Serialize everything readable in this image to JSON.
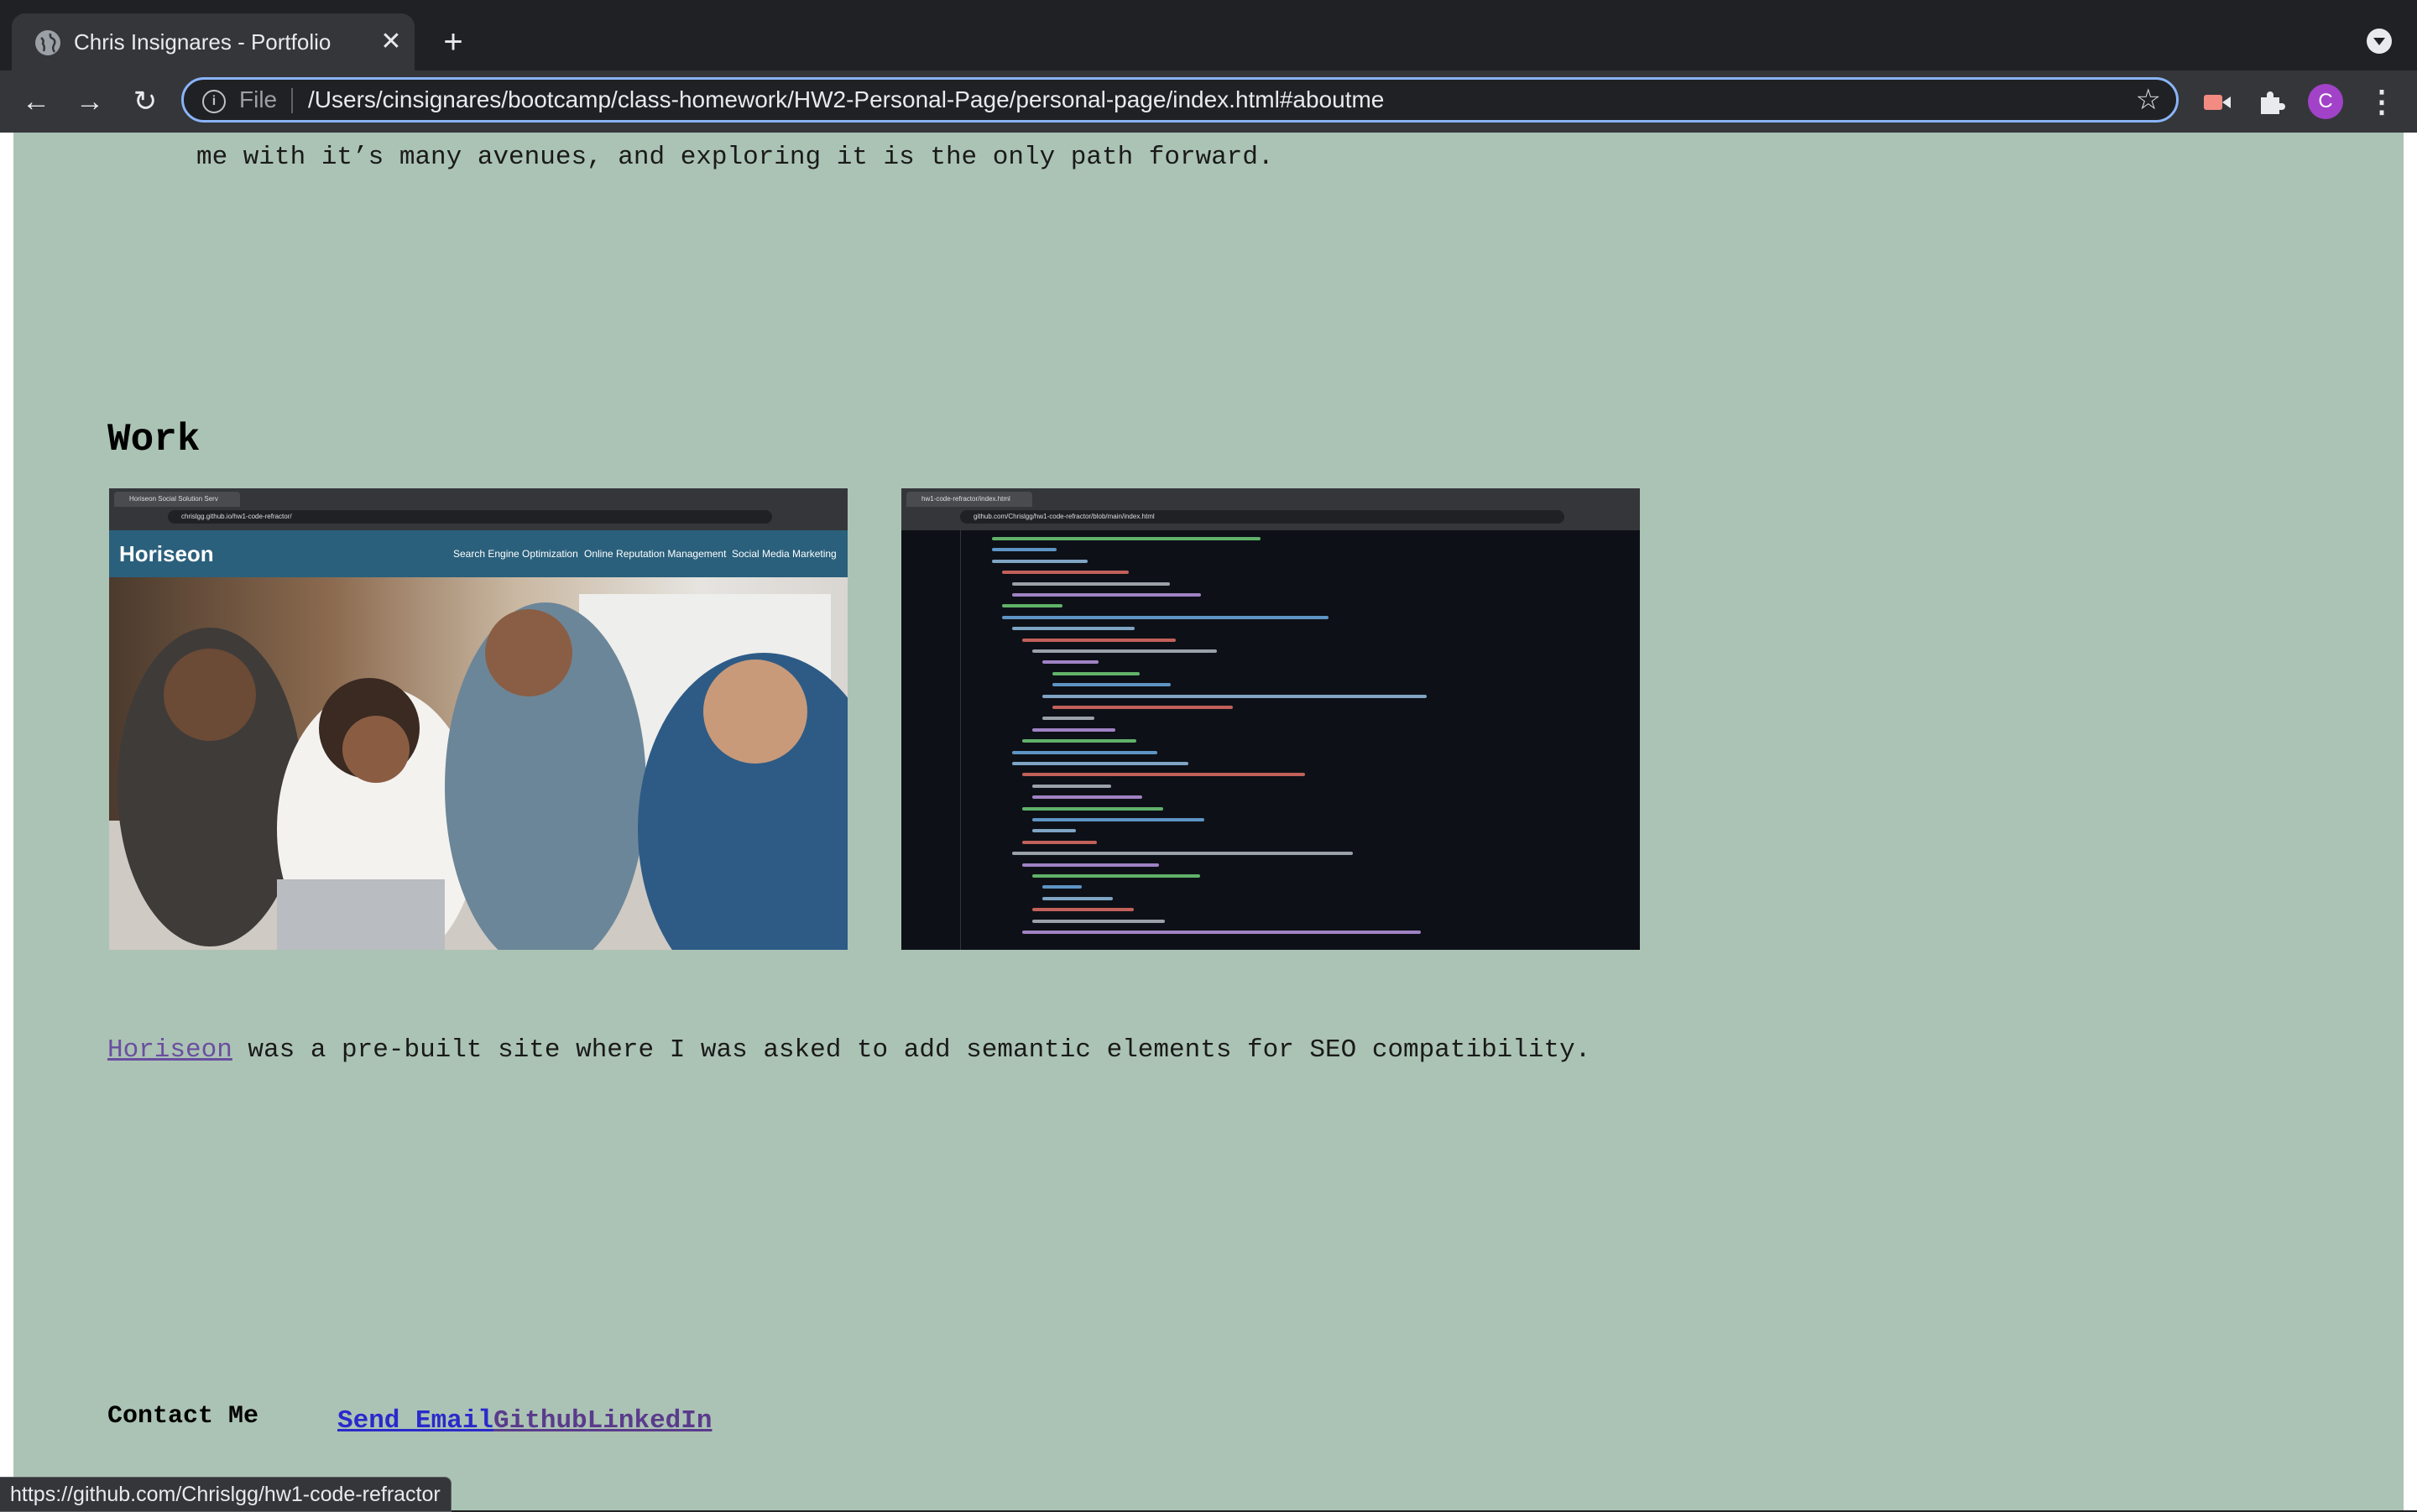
{
  "browser": {
    "tab_title": "Chris Insignares - Portfolio",
    "tab_close_glyph": "✕",
    "new_tab_glyph": "+",
    "back_glyph": "←",
    "forward_glyph": "→",
    "reload_glyph": "↻",
    "scheme_label": "File",
    "url": "/Users/cinsignares/bootcamp/class-homework/HW2-Personal-Page/personal-page/index.html#aboutme",
    "bookmark_glyph": "☆",
    "profile_initial": "C",
    "menu_glyph": "⋮",
    "status_url": "https://github.com/Chrislgg/hw1-code-refractor"
  },
  "page": {
    "intro_tail": "me with it’s many avenues, and exploring it is the only path forward.",
    "work": {
      "heading": "Work",
      "thumb_horiseon": {
        "tab_label": "Horiseon Social Solution Serv",
        "url": "chrislgg.github.io/hw1-code-refractor/",
        "logo": "Horiseon",
        "nav": [
          "Search Engine Optimization",
          "Online Reputation Management",
          "Social Media Marketing"
        ]
      },
      "thumb_code": {
        "tab_label": "hw1-code-refractor/index.html",
        "url": "github.com/Chrislgg/hw1-code-refractor/blob/main/index.html"
      },
      "caption_link": "Horiseon",
      "caption_text": " was a pre-built site where I was asked to add semantic elements for SEO compatibility."
    },
    "contact": {
      "heading": "Contact Me",
      "links": [
        "Send Email",
        "Github",
        "LinkedIn"
      ]
    }
  },
  "colors": {
    "page_background": "#abc3b4",
    "link_unvisited": "#2a2acb",
    "link_visited": "#5a3b8c",
    "omnibox_focus": "#8ab4f8",
    "avatar": "#a142c8"
  },
  "icons": [
    "globe-icon",
    "info-icon",
    "star-icon",
    "cast-icon",
    "puzzle-icon",
    "tab-search-icon"
  ]
}
